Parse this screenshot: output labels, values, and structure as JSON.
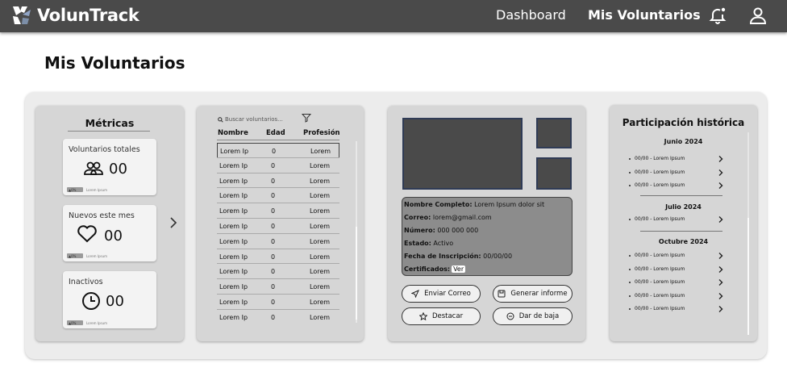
{
  "app": {
    "name": "VolunTrack"
  },
  "nav": {
    "dashboard": "Dashboard",
    "my_volunteers": "Mis Voluntarios",
    "icons": [
      "bell-icon",
      "user-icon"
    ]
  },
  "page": {
    "title": "Mis Voluntarios"
  },
  "metrics": {
    "title": "Métricas",
    "cards": [
      {
        "label": "Voluntarios totales",
        "value": "00",
        "icon": "people-icon",
        "badge": "0%",
        "note": "Lorem Ipsum"
      },
      {
        "label": "Nuevos este mes",
        "value": "00",
        "icon": "heart-icon",
        "badge": "0%",
        "note": "Lorem Ipsum"
      },
      {
        "label": "Inactivos",
        "value": "00",
        "icon": "clock-icon",
        "badge": "0%",
        "note": "Lorem Ipsum"
      }
    ]
  },
  "list": {
    "search_placeholder": "Buscar voluntarios...",
    "columns": [
      "Nombre",
      "Edad",
      "Profesión"
    ],
    "rows": [
      [
        "Lorem Ip",
        "0",
        "Lorem"
      ],
      [
        "Lorem Ip",
        "0",
        "Lorem"
      ],
      [
        "Lorem Ip",
        "0",
        "Lorem"
      ],
      [
        "Lorem Ip",
        "0",
        "Lorem"
      ],
      [
        "Lorem Ip",
        "0",
        "Lorem"
      ],
      [
        "Lorem Ip",
        "0",
        "Lorem"
      ],
      [
        "Lorem Ip",
        "0",
        "Lorem"
      ],
      [
        "Lorem Ip",
        "0",
        "Lorem"
      ],
      [
        "Lorem Ip",
        "0",
        "Lorem"
      ],
      [
        "Lorem Ip",
        "0",
        "Lorem"
      ],
      [
        "Lorem Ip",
        "0",
        "Lorem"
      ],
      [
        "Lorem Ip",
        "0",
        "Lorem"
      ]
    ]
  },
  "detail": {
    "fields": [
      {
        "label": "Nombre Completo:",
        "value": " Lorem Ipsum dolor sit"
      },
      {
        "label": "Correo:",
        "value": " lorem@gmail.com"
      },
      {
        "label": "Número:",
        "value": " 000 000 000"
      },
      {
        "label": "Estado:",
        "value": " Activo"
      },
      {
        "label": "Fecha de Inscripción:",
        "value": " 00/00/00"
      },
      {
        "label": "Certificados:",
        "value": ""
      }
    ],
    "certificates_button": "Ver",
    "actions": {
      "send_email": "Enviar Correo",
      "generate_report": "Generar informe",
      "highlight": "Destacar",
      "unsubscribe": "Dar de baja"
    }
  },
  "history": {
    "title": "Participación histórica",
    "groups": [
      {
        "month": "Junio 2024",
        "items": [
          "00/00 - Lorem Ipsum",
          "00/00 - Lorem Ipsum",
          "00/00 - Lorem Ipsum"
        ]
      },
      {
        "month": "Julio 2024",
        "items": [
          "00/00 - Lorem Ipsum"
        ]
      },
      {
        "month": "Octubre 2024",
        "items": [
          "00/00 - Lorem Ipsum",
          "00/00 - Lorem Ipsum",
          "00/00 - Lorem Ipsum",
          "00/00 - Lorem Ipsum",
          "00/00 - Lorem Ipsum"
        ]
      }
    ]
  },
  "colors": {
    "topbar": "#4a4a4a",
    "panel": "#d6d6d6",
    "board": "#ececec",
    "info_box": "#8c8c8c"
  }
}
